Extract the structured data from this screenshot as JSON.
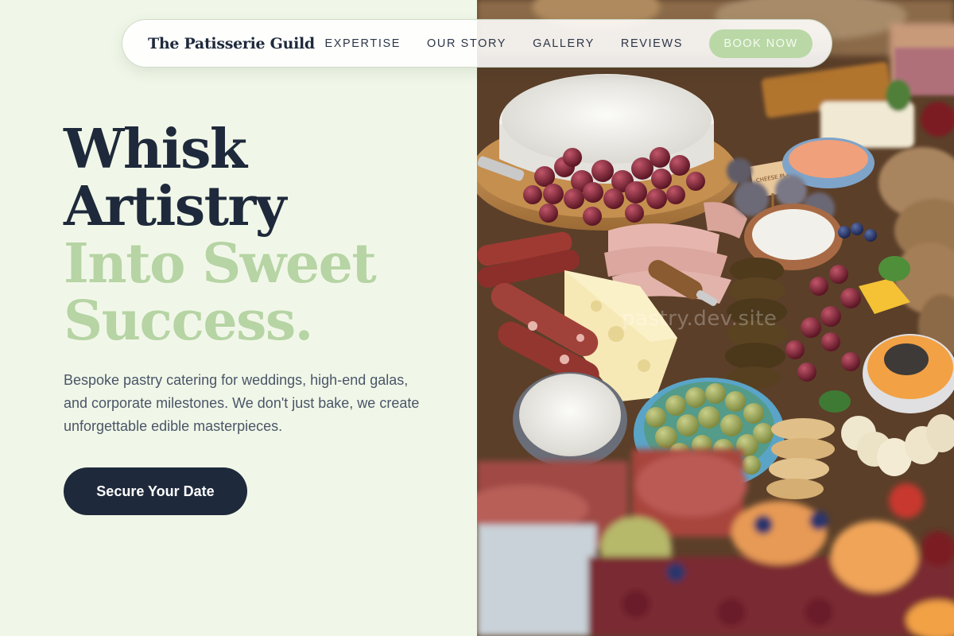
{
  "nav": {
    "brand": "The Patisserie Guild",
    "links": [
      "EXPERTISE",
      "OUR STORY",
      "GALLERY",
      "REVIEWS"
    ],
    "book_label": "BOOK NOW"
  },
  "hero": {
    "headline_line1": "Whisk",
    "headline_line2": "Artistry",
    "headline_line3": "Into Sweet",
    "headline_line4": "Success.",
    "description": "Bespoke pastry catering for weddings, high-end galas, and corporate milestones. We don't just bake, we create unforgettable edible masterpieces.",
    "cta_label": "Secure Your Date"
  },
  "image": {
    "watermark": "pastry.dev.site",
    "cheese_sign": "CHEESE PLATTER"
  },
  "colors": {
    "background": "#f1f7e8",
    "navy": "#1e293b",
    "sage": "#b6d4a4",
    "book_button": "#b9d8a6"
  }
}
